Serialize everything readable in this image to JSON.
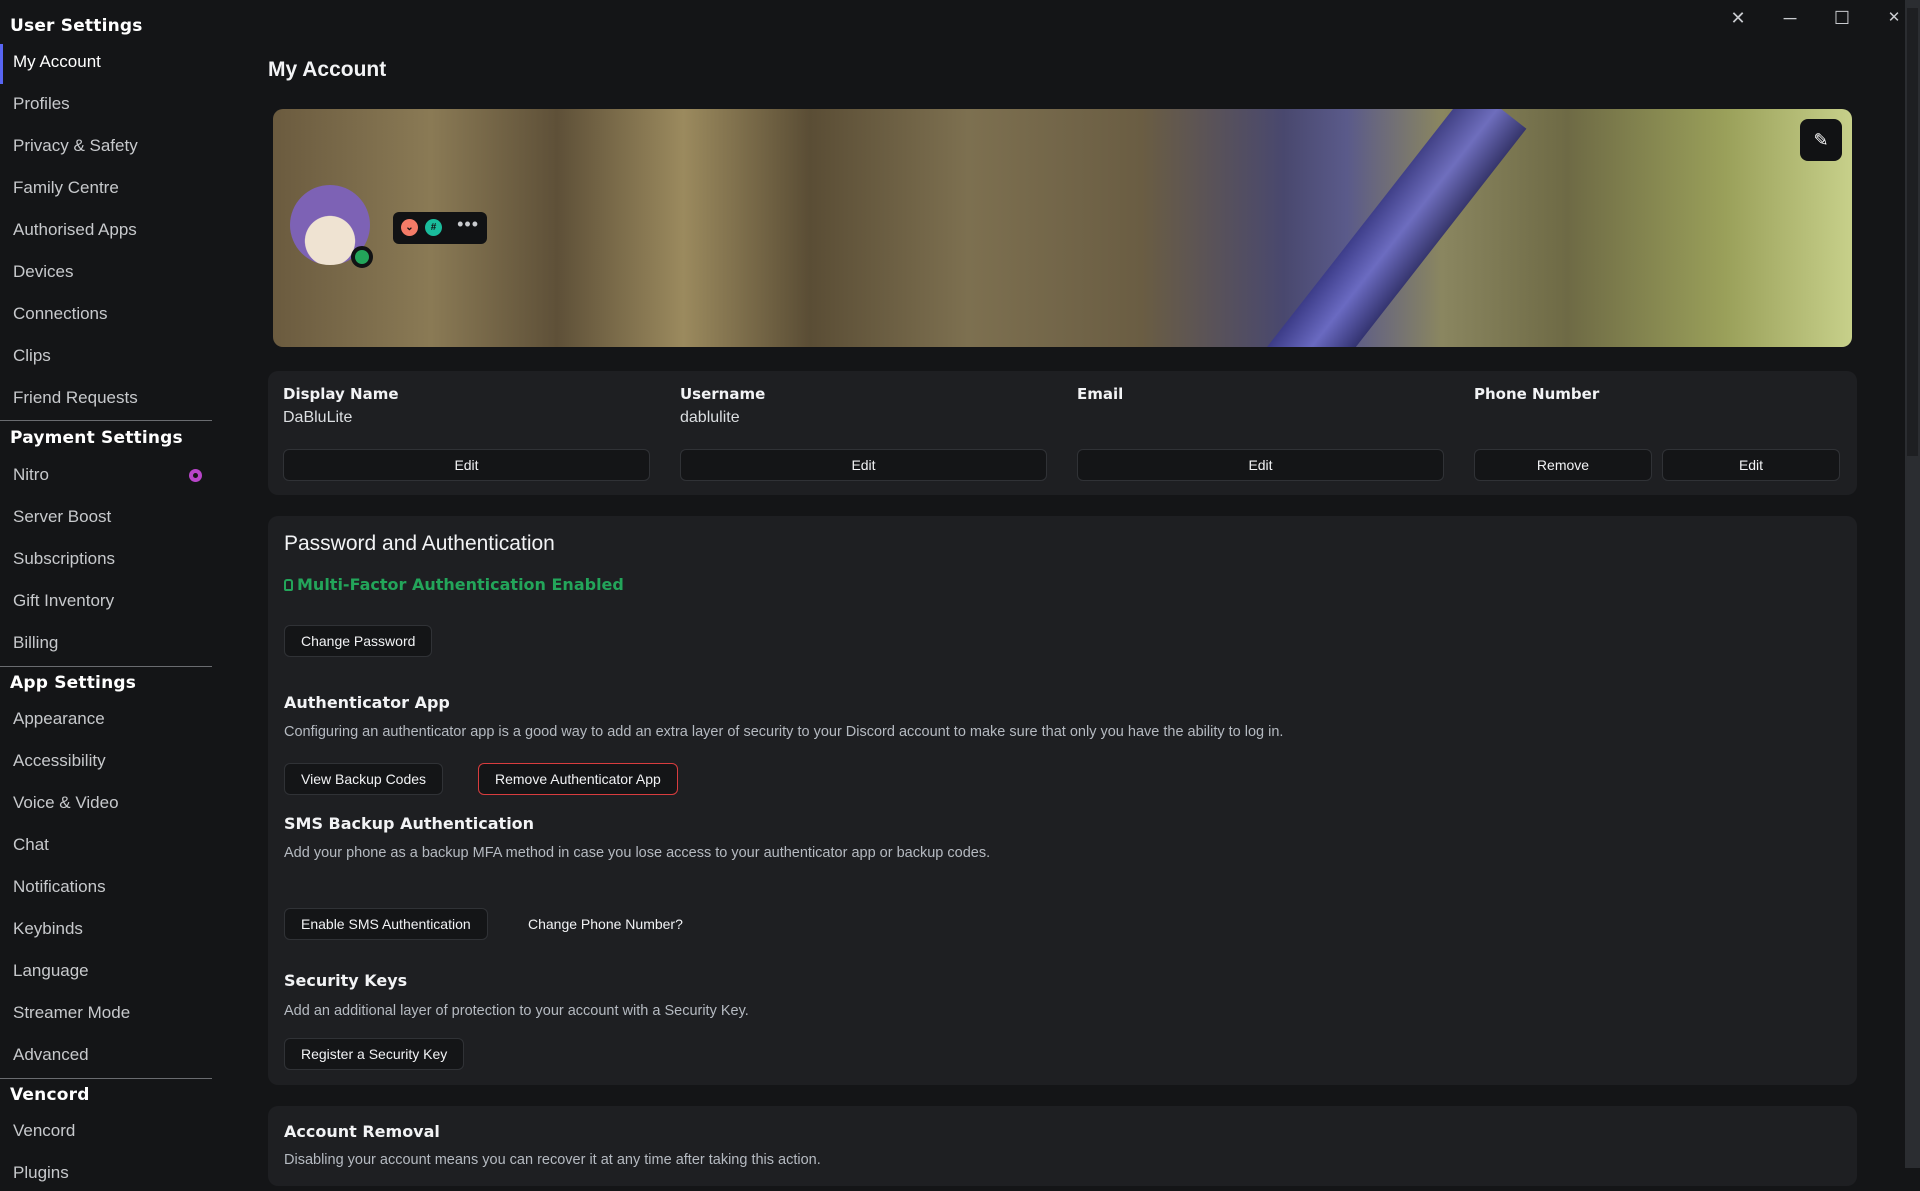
{
  "window": {
    "controls": {
      "close_settings": "✕",
      "minimize": "─",
      "maximize": "☐",
      "close": "✕"
    }
  },
  "sidebar": {
    "sections": [
      {
        "header": "User Settings",
        "items": [
          "My Account",
          "Profiles",
          "Privacy & Safety",
          "Family Centre",
          "Authorised Apps",
          "Devices",
          "Connections",
          "Clips",
          "Friend Requests"
        ]
      },
      {
        "header": "Payment Settings",
        "items": [
          "Nitro",
          "Server Boost",
          "Subscriptions",
          "Gift Inventory",
          "Billing"
        ]
      },
      {
        "header": "App Settings",
        "items": [
          "Appearance",
          "Accessibility",
          "Voice & Video",
          "Chat",
          "Notifications",
          "Keybinds",
          "Language",
          "Streamer Mode",
          "Advanced"
        ]
      },
      {
        "header": "Vencord",
        "items": [
          "Vencord",
          "Plugins"
        ]
      }
    ],
    "active_item": "My Account",
    "nitro_icon": "nitro-icon"
  },
  "main": {
    "title": "My Account",
    "profile": {
      "status": "online",
      "status_color": "#23a55a",
      "badges": [
        {
          "name": "hypesquad-icon",
          "glyph": "⌄",
          "color": "#f47b67"
        },
        {
          "name": "hashtag-badge-icon",
          "glyph": "#",
          "color": "#1abc9c"
        }
      ],
      "more_glyph": "•••",
      "edit_glyph": "✎"
    },
    "account_info": {
      "fields": [
        {
          "label": "Display Name",
          "value": "DaBluLite",
          "buttons": [
            "Edit"
          ]
        },
        {
          "label": "Username",
          "value": "dablulite",
          "buttons": [
            "Edit"
          ]
        },
        {
          "label": "Email",
          "value": "",
          "buttons": [
            "Edit"
          ]
        },
        {
          "label": "Phone Number",
          "value": "",
          "buttons": [
            "Remove",
            "Edit"
          ]
        }
      ]
    },
    "password_auth": {
      "title": "Password and Authentication",
      "mfa_status": "Multi-Factor Authentication Enabled",
      "mfa_color": "#23a55a",
      "change_password": "Change Password",
      "authenticator": {
        "title": "Authenticator App",
        "description": "Configuring an authenticator app is a good way to add an extra layer of security to your Discord account to make sure that only you have the ability to log in.",
        "view_backup": "View Backup Codes",
        "remove": "Remove Authenticator App"
      },
      "sms": {
        "title": "SMS Backup Authentication",
        "description": "Add your phone as a backup MFA method in case you lose access to your authenticator app or backup codes.",
        "enable": "Enable SMS Authentication",
        "change_phone": "Change Phone Number?"
      },
      "security_keys": {
        "title": "Security Keys",
        "description": "Add an additional layer of protection to your account with a Security Key.",
        "register": "Register a Security Key"
      }
    },
    "account_removal": {
      "title": "Account Removal",
      "description": "Disabling your account means you can recover it at any time after taking this action."
    }
  }
}
